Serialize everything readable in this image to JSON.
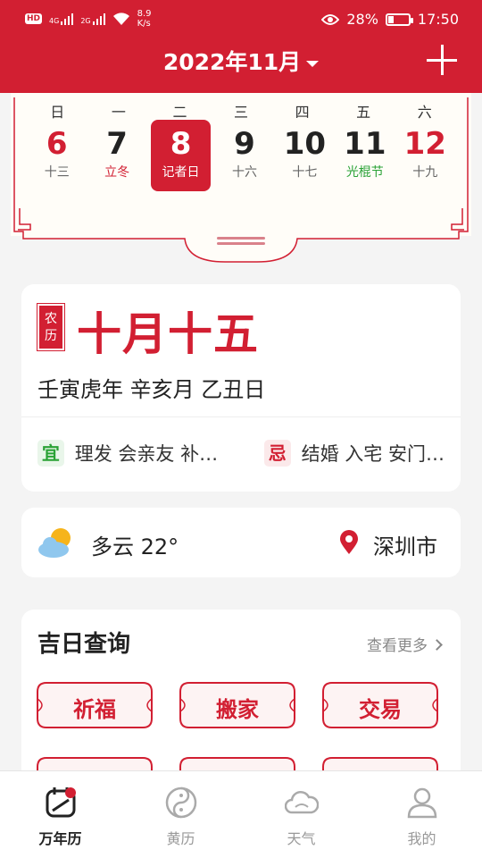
{
  "status_bar": {
    "network": "HD",
    "signal1": "4G",
    "signal2": "2G",
    "speed_value": "8.9",
    "speed_unit": "K/s",
    "battery": "28%",
    "battery_level": 0.28,
    "time": "17:50"
  },
  "header": {
    "month_title": "2022年11月"
  },
  "week": {
    "weekdays": [
      "日",
      "一",
      "二",
      "三",
      "四",
      "五",
      "六"
    ],
    "days": [
      {
        "num": "6",
        "sub": "十三"
      },
      {
        "num": "7",
        "sub": "立冬"
      },
      {
        "num": "8",
        "sub": "记者日"
      },
      {
        "num": "9",
        "sub": "十六"
      },
      {
        "num": "10",
        "sub": "十七"
      },
      {
        "num": "11",
        "sub": "光棍节"
      },
      {
        "num": "12",
        "sub": "十九"
      }
    ]
  },
  "lunar": {
    "tag": "农历",
    "date": "十月十五",
    "ganzhi": "壬寅虎年  辛亥月  乙丑日",
    "yi_label": "宜",
    "yi_text": "理发 会亲友 补…",
    "ji_label": "忌",
    "ji_text": "结婚 入宅 安门…"
  },
  "weather": {
    "condition_temp": "多云  22°",
    "location": "深圳市"
  },
  "lucky": {
    "title": "吉日查询",
    "more": "查看更多",
    "items": [
      "祈福",
      "搬家",
      "交易"
    ]
  },
  "nav": {
    "items": [
      "万年历",
      "黄历",
      "天气",
      "我的"
    ]
  },
  "colors": {
    "brand_red": "#d21f32",
    "green": "#2aa236"
  }
}
